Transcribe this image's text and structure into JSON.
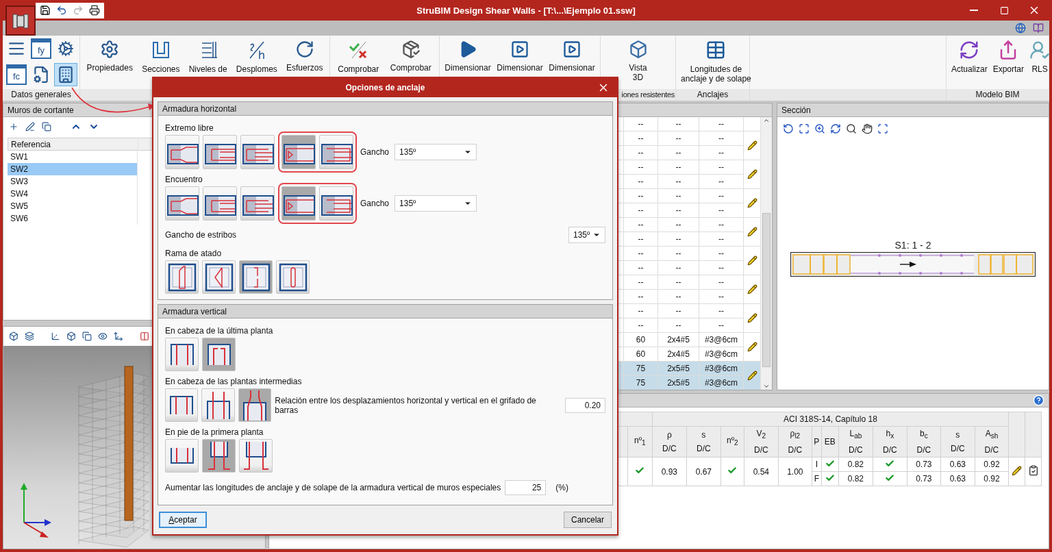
{
  "window": {
    "title": "StruBIM Design Shear Walls - [T:\\...\\Ejemplo 01.ssw]"
  },
  "ribbon": {
    "groups": [
      {
        "kind": "tools",
        "label": "Datos generales",
        "tools": [
          {
            "selected": false
          },
          {
            "label": "fy",
            "selected": false
          },
          {
            "selected": false
          },
          {
            "label": "fc",
            "selected": false
          },
          {
            "selected": false
          },
          {
            "selected": true
          }
        ]
      },
      {
        "kind": "buttons",
        "buttons": [
          {
            "lines": [
              "Propiedades"
            ]
          },
          {
            "lines": [
              "Secciones"
            ]
          },
          {
            "lines": [
              "Niveles de"
            ]
          },
          {
            "lines": [
              "Desplomes"
            ]
          },
          {
            "lines": [
              "Esfuerzos"
            ]
          }
        ]
      },
      {
        "kind": "buttons",
        "buttons": [
          {
            "lines": [
              "Comprobar"
            ]
          },
          {
            "lines": [
              "Comprobar"
            ]
          }
        ]
      },
      {
        "kind": "buttons",
        "buttons": [
          {
            "lines": [
              "Dimensionar"
            ]
          },
          {
            "lines": [
              "Dimensionar"
            ]
          },
          {
            "lines": [
              "Dimensionar"
            ]
          }
        ]
      },
      {
        "kind": "buttons",
        "label": "iones resistentes",
        "buttons": [
          {
            "lines": [
              "Vista",
              "3D"
            ]
          }
        ]
      },
      {
        "kind": "buttons",
        "label": "Anclajes",
        "buttons": [
          {
            "lines": [
              "Longitudes de",
              "anclaje y de solape"
            ]
          }
        ]
      },
      {
        "kind": "empty"
      },
      {
        "kind": "buttons",
        "label": "Modelo BIM",
        "buttons": [
          {
            "lines": [
              "Actualizar"
            ]
          },
          {
            "lines": [
              "Exportar"
            ]
          },
          {
            "lines": [
              "RLS"
            ]
          }
        ]
      }
    ]
  },
  "walls_panel": {
    "title": "Muros de cortante",
    "column": "Referencia",
    "rows": [
      {
        "name": "SW1",
        "selected": false
      },
      {
        "name": "SW2",
        "selected": true
      },
      {
        "name": "SW3",
        "selected": false
      },
      {
        "name": "SW4",
        "selected": false
      },
      {
        "name": "SW5",
        "selected": false
      },
      {
        "name": "SW6",
        "selected": false
      }
    ]
  },
  "wall_table": {
    "groups": [
      {
        "rows": [
          [
            "--",
            "--",
            "--"
          ]
        ],
        "edit": false,
        "selected": false
      },
      {
        "rows": [
          [
            "--",
            "--",
            "--"
          ],
          [
            "--",
            "--",
            "--"
          ]
        ],
        "edit": true,
        "selected": false
      },
      {
        "rows": [
          [
            "--",
            "--",
            "--"
          ],
          [
            "--",
            "--",
            "--"
          ]
        ],
        "edit": true,
        "selected": false
      },
      {
        "rows": [
          [
            "--",
            "--",
            "--"
          ],
          [
            "--",
            "--",
            "--"
          ]
        ],
        "edit": true,
        "selected": false
      },
      {
        "rows": [
          [
            "--",
            "--",
            "--"
          ],
          [
            "--",
            "--",
            "--"
          ]
        ],
        "edit": true,
        "selected": false
      },
      {
        "rows": [
          [
            "--",
            "--",
            "--"
          ],
          [
            "--",
            "--",
            "--"
          ]
        ],
        "edit": true,
        "selected": false
      },
      {
        "rows": [
          [
            "--",
            "--",
            "--"
          ],
          [
            "--",
            "--",
            "--"
          ]
        ],
        "edit": true,
        "selected": false
      },
      {
        "rows": [
          [
            "--",
            "--",
            "--"
          ],
          [
            "--",
            "--",
            "--"
          ]
        ],
        "edit": true,
        "selected": false
      },
      {
        "rows": [
          [
            "60",
            "2x4#5",
            "#3@6cm"
          ],
          [
            "60",
            "2x4#5",
            "#3@6cm"
          ]
        ],
        "edit": true,
        "selected": false
      },
      {
        "rows": [
          [
            "75",
            "2x5#5",
            "#3@6cm"
          ],
          [
            "75",
            "2x5#5",
            "#3@6cm"
          ]
        ],
        "edit": true,
        "selected": true
      }
    ]
  },
  "section_panel": {
    "title": "Sección",
    "label": "S1: 1 - 2"
  },
  "results": {
    "header": "ACI 318S-14, Capítulo 18",
    "columns": [
      {
        "symbol": "nº$_{1}$"
      },
      {
        "symbol": "ρ",
        "unit": "D/C"
      },
      {
        "symbol": "s",
        "unit": "D/C"
      },
      {
        "symbol": "nº$_{2}$"
      },
      {
        "symbol": "V$_{2}$",
        "unit": "D/C"
      },
      {
        "symbol": "ρ$_{l2}$",
        "unit": "D/C"
      },
      {
        "symbol": "P"
      },
      {
        "symbol": "EB"
      },
      {
        "symbol": "L$_{ab}$",
        "unit": "D/C"
      },
      {
        "symbol": "h$_{x}$",
        "unit": "D/C"
      },
      {
        "symbol": "b$_{c}$",
        "unit": "D/C"
      },
      {
        "symbol": "s",
        "unit": "D/C"
      },
      {
        "symbol": "A$_{sh}$",
        "unit": "D/C"
      }
    ],
    "shared": [
      {
        "kind": "check"
      },
      {
        "kind": "text",
        "text": "0.93"
      },
      {
        "kind": "text",
        "text": "0.67"
      },
      {
        "kind": "check"
      },
      {
        "kind": "text",
        "text": "0.54"
      },
      {
        "kind": "text",
        "text": "1.00"
      }
    ],
    "sub_rows": [
      [
        {
          "kind": "text",
          "text": "I"
        },
        {
          "kind": "check"
        },
        {
          "kind": "text",
          "text": "0.82"
        },
        {
          "kind": "check"
        },
        {
          "kind": "text",
          "text": "0.73"
        },
        {
          "kind": "text",
          "text": "0.63"
        },
        {
          "kind": "text",
          "text": "0.92"
        }
      ],
      [
        {
          "kind": "text",
          "text": "F"
        },
        {
          "kind": "check"
        },
        {
          "kind": "text",
          "text": "0.82"
        },
        {
          "kind": "check"
        },
        {
          "kind": "text",
          "text": "0.73"
        },
        {
          "kind": "text",
          "text": "0.63"
        },
        {
          "kind": "text",
          "text": "0.92"
        }
      ]
    ]
  },
  "dialog": {
    "title": "Opciones de anclaje",
    "sections": [
      {
        "title": "Armadura horizontal",
        "items": [
          {
            "kind": "tiles",
            "label": "Extremo libre",
            "options": [
              {
                "selected": false,
                "highlighted": false
              },
              {
                "selected": false,
                "highlighted": false
              },
              {
                "selected": false,
                "highlighted": false
              },
              {
                "selected": true,
                "highlighted": true
              },
              {
                "selected": false,
                "highlighted": true
              }
            ],
            "select": {
              "label": "Gancho",
              "value": "135º"
            }
          },
          {
            "kind": "tiles",
            "label": "Encuentro",
            "options": [
              {
                "selected": false,
                "highlighted": false
              },
              {
                "selected": false,
                "highlighted": false
              },
              {
                "selected": false,
                "highlighted": false
              },
              {
                "selected": true,
                "highlighted": true
              },
              {
                "selected": false,
                "highlighted": true
              }
            ],
            "select": {
              "label": "Gancho",
              "value": "135º"
            }
          },
          {
            "kind": "select",
            "label": "Gancho de estribos",
            "value": "135º"
          },
          {
            "kind": "tiles",
            "label": "Rama de atado",
            "options": [
              {
                "selected": false,
                "highlighted": false
              },
              {
                "selected": false,
                "highlighted": false
              },
              {
                "selected": true,
                "highlighted": false
              },
              {
                "selected": false,
                "highlighted": false
              }
            ]
          }
        ]
      },
      {
        "title": "Armadura vertical",
        "items": [
          {
            "kind": "tiles",
            "label": "En cabeza de la última planta",
            "options": [
              {
                "selected": false,
                "highlighted": false
              },
              {
                "selected": true,
                "highlighted": false
              }
            ]
          },
          {
            "kind": "tiles",
            "label": "En cabeza de las plantas intermedias",
            "options": [
              {
                "selected": false,
                "highlighted": false
              },
              {
                "selected": false,
                "highlighted": false
              },
              {
                "selected": true,
                "highlighted": false
              }
            ],
            "input": {
              "label": "Relación entre los desplazamientos horizontal y vertical en el grifado de barras",
              "value": "0.20"
            }
          },
          {
            "kind": "tiles",
            "label": "En pie de la primera planta",
            "options": [
              {
                "selected": false,
                "highlighted": false
              },
              {
                "selected": true,
                "highlighted": false
              },
              {
                "selected": false,
                "highlighted": false
              }
            ]
          },
          {
            "kind": "input",
            "label": "Aumentar las longitudes de anclaje y de solape de la armadura vertical de muros especiales",
            "value": "25",
            "unit": "(%)"
          }
        ]
      }
    ],
    "buttons": [
      {
        "label": "Aceptar",
        "default": true
      },
      {
        "label": "Cancelar",
        "default": false
      }
    ]
  }
}
